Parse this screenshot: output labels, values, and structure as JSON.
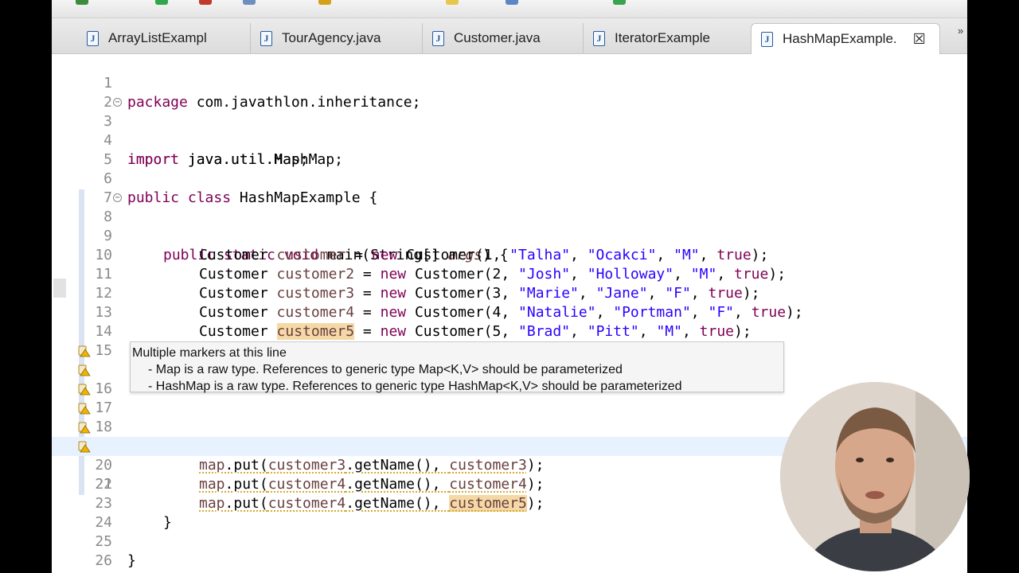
{
  "tabs": [
    {
      "label": "ArrayListExampl",
      "icon": "java-file-icon"
    },
    {
      "label": "TourAgency.java",
      "icon": "java-file-icon"
    },
    {
      "label": "Customer.java",
      "icon": "java-file-icon"
    },
    {
      "label": "IteratorExample",
      "icon": "java-file-icon"
    },
    {
      "label": "HashMapExample.",
      "icon": "java-file-icon",
      "active": true
    }
  ],
  "tab_close_symbol": "☒",
  "tab_overflow_symbol": "»",
  "line_numbers": [
    "1",
    "2",
    "3",
    "4",
    "5",
    "6",
    "7",
    "8",
    "9",
    "10",
    "11",
    "12",
    "13",
    "14",
    "15",
    "16",
    "17",
    "18",
    "19",
    "20",
    "21",
    "22",
    "23",
    "24",
    "25",
    "26"
  ],
  "code": {
    "l1": {
      "kw": "package",
      "rest": " com.javathlon.inheritance;"
    },
    "l3": {
      "kw": "import",
      "rest": " java.util.HashMap;"
    },
    "l4": {
      "kw": "import",
      "rest": " java.util.Map;"
    },
    "l6": {
      "kw1": "public",
      "kw2": "class",
      "rest": " HashMapExample {"
    },
    "l8": {
      "kw1": "public",
      "kw2": "static",
      "kw3": "void",
      "rest": " main(String[] ",
      "arg": "args",
      "end": ") {"
    },
    "l9": {
      "type": "Customer ",
      "var": "customer",
      "eq": " = ",
      "kw": "new",
      "call": " Customer(1, ",
      "s1": "\"Talha\"",
      "s2": "\"Ocakci\"",
      "s3": "\"M\"",
      "b": "true",
      "end": ");"
    },
    "l10": {
      "type": "Customer ",
      "var": "customer2",
      "eq": " = ",
      "kw": "new",
      "call": " Customer(2, ",
      "s1": "\"Josh\"",
      "s2": "\"Holloway\"",
      "s3": "\"M\"",
      "b": "true",
      "end": ");"
    },
    "l11": {
      "type": "Customer ",
      "var": "customer3",
      "eq": " = ",
      "kw": "new",
      "call": " Customer(3, ",
      "s1": "\"Marie\"",
      "s2": "\"Jane\"",
      "s3": "\"F\"",
      "b": "true",
      "end": ");"
    },
    "l12": {
      "type": "Customer ",
      "var": "customer4",
      "eq": " = ",
      "kw": "new",
      "call": " Customer(4, ",
      "s1": "\"Natalie\"",
      "s2": "\"Portman\"",
      "s3": "\"F\"",
      "b": "true",
      "end": ");"
    },
    "l13": {
      "type": "Customer ",
      "var": "customer5",
      "eq": " = ",
      "kw": "new",
      "call": " Customer(5, ",
      "s1": "\"Brad\"",
      "s2": "\"Pitt\"",
      "s3": "\"M\"",
      "b": "true",
      "end": ");"
    },
    "l19": {
      "map": "map",
      "put": ".put(",
      "v1": "customer3",
      "mid": ".getName(), ",
      "v2": "customer3",
      "end": ");"
    },
    "l20": {
      "map": "map",
      "put": ".put(",
      "v1": "customer4",
      "mid": ".getName(), ",
      "v2": "customer4",
      "end": ");"
    },
    "l21": {
      "map": "map",
      "put": ".put(",
      "v1": "customer4",
      "mid": ".getName(), ",
      "v2": "customer5",
      "end": ");"
    },
    "l23": "}",
    "l25": "}"
  },
  "tooltip": {
    "title": "Multiple markers at this line",
    "items": [
      "- Map is a raw type. References to generic type Map<K,V> should be parameterized",
      "- HashMap is a raw type. References to generic type HashMap<K,V> should be parameterized"
    ]
  },
  "colors": {
    "keyword": "#7f0055",
    "string": "#2a00ff",
    "local_variable": "#6a3e3e",
    "occurrence_highlight": "#f4d9a7",
    "current_line": "#e8f2fe",
    "warning": "#f0b400"
  }
}
